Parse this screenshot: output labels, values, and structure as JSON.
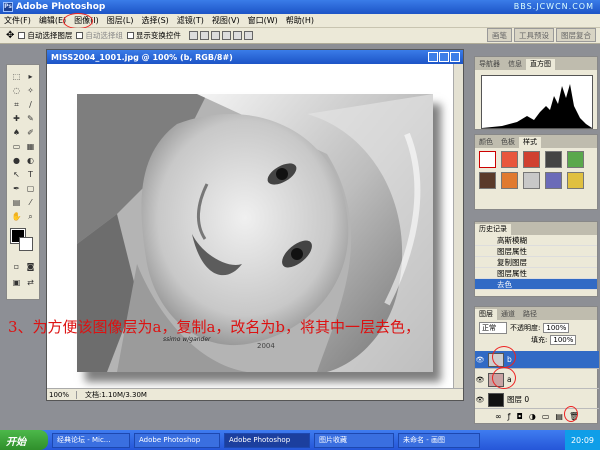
{
  "app": {
    "title": "Adobe Photoshop",
    "watermark": "BBS.JCWCN.COM"
  },
  "menu": [
    "文件(F)",
    "编辑(E)",
    "图像(I)",
    "图层(L)",
    "选择(S)",
    "滤镜(T)",
    "视图(V)",
    "窗口(W)",
    "帮助(H)"
  ],
  "options": {
    "auto_select": "自动选择图层",
    "auto_select_group": "自动选择组",
    "show_transform": "显示变换控件",
    "palette_tabs": [
      "画笔",
      "工具预设",
      "图层复合"
    ]
  },
  "document": {
    "title": "MISS2004_1001.jpg @ 100% (b, RGB/8#)",
    "zoom": "100%",
    "docsize": "文档:1.10M/3.30M",
    "signature": "ssimo w/gander",
    "year": "2004"
  },
  "annotation": "3、为方便该图像层为a，复制a，改名为b，将其中一层去色，",
  "panels": {
    "navigator": {
      "tabs": [
        "导航器",
        "信息",
        "直方图"
      ]
    },
    "swatches": {
      "tabs": [
        "颜色",
        "色板",
        "样式"
      ]
    },
    "history": {
      "tab": "历史记录",
      "items": [
        "高斯模糊",
        "图层属性",
        "复制图层",
        "图层属性",
        "去色"
      ]
    },
    "layers": {
      "tabs": [
        "图层",
        "通道",
        "路径"
      ],
      "blend_mode": "正常",
      "opacity_label": "不透明度:",
      "opacity": "100%",
      "fill_label": "填充:",
      "fill": "100%",
      "layer_b": "b",
      "layer_a": "a",
      "layer_bg": "图层 0"
    }
  },
  "taskbar": {
    "start": "开始",
    "items": [
      "经典论坛 - Mic...",
      "Adobe Photoshop",
      "Adobe Photoshop",
      "图片收藏",
      "未命名 - 画图"
    ],
    "clock": "20:09"
  }
}
